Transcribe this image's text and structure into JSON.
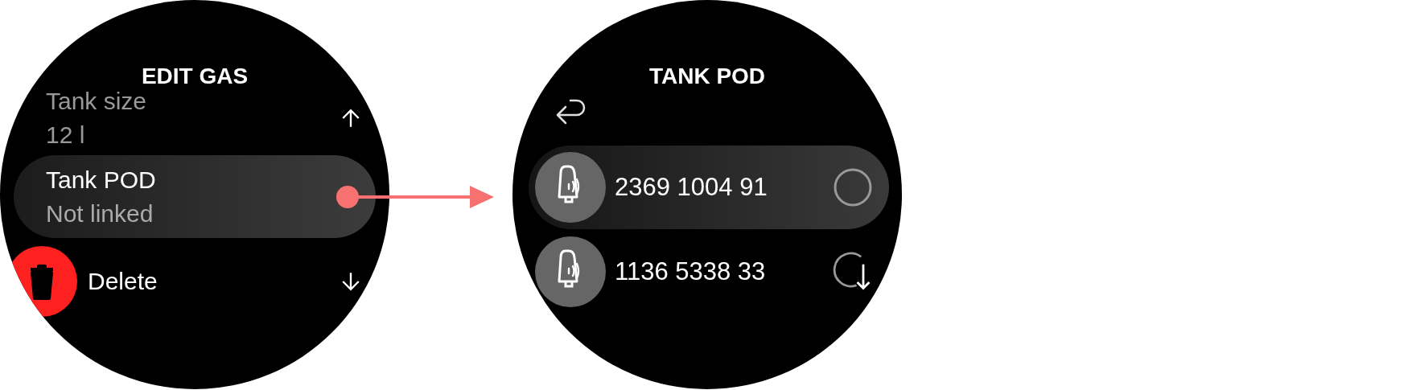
{
  "edit_screen": {
    "title": "EDIT GAS",
    "items": [
      {
        "kind": "setting",
        "label": "Tank size",
        "value": "12 l",
        "selected": false,
        "dimmed": true
      },
      {
        "kind": "setting",
        "label": "Tank POD",
        "value": "Not linked",
        "selected": true,
        "dimmed": false
      },
      {
        "kind": "action",
        "label": "Delete",
        "selected": false,
        "dimmed": false
      }
    ]
  },
  "pod_screen": {
    "title": "TANK POD",
    "pods": [
      {
        "serial": "2369 1004 91",
        "selected": true,
        "kind": "idle"
      },
      {
        "serial": "1136 5338 33",
        "selected": false,
        "kind": "download"
      }
    ]
  }
}
